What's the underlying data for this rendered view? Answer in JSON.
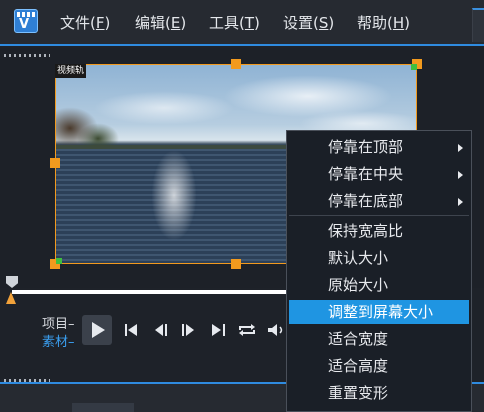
{
  "menubar": {
    "logo_icon": "app-logo-icon",
    "items": [
      {
        "label": "文件",
        "accel": "F"
      },
      {
        "label": "编辑",
        "accel": "E"
      },
      {
        "label": "工具",
        "accel": "T"
      },
      {
        "label": "设置",
        "accel": "S"
      },
      {
        "label": "帮助",
        "accel": "H"
      }
    ]
  },
  "preview": {
    "track_label": "视频轨"
  },
  "transport": {
    "mode_project": "项目",
    "mode_clip": "素材",
    "buttons": [
      "play-icon",
      "go-to-start-icon",
      "previous-frame-icon",
      "next-frame-icon",
      "go-to-end-icon",
      "repeat-icon",
      "volume-icon"
    ]
  },
  "context_menu": {
    "items": [
      {
        "label": "停靠在顶部",
        "has_submenu": true
      },
      {
        "label": "停靠在中央",
        "has_submenu": true
      },
      {
        "label": "停靠在底部",
        "has_submenu": true
      },
      {
        "label": "保持宽高比",
        "has_submenu": false
      },
      {
        "label": "默认大小",
        "has_submenu": false
      },
      {
        "label": "原始大小",
        "has_submenu": false
      },
      {
        "label": "调整到屏幕大小",
        "has_submenu": false,
        "selected": true
      },
      {
        "label": "适合宽度",
        "has_submenu": false
      },
      {
        "label": "适合高度",
        "has_submenu": false
      },
      {
        "label": "重置变形",
        "has_submenu": false
      }
    ]
  },
  "colors": {
    "accent": "#2f8be0",
    "selection": "#1f95e2",
    "handle": "#f29a1e",
    "clip_mode": "#3a9ff0"
  }
}
